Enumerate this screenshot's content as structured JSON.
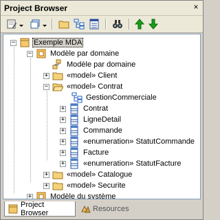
{
  "window": {
    "title": "Project Browser"
  },
  "toolbar": {
    "buttons": [
      "new-element",
      "element-type",
      "new-package",
      "new-diagram",
      "properties",
      "find",
      "move-up",
      "move-down"
    ]
  },
  "tree": {
    "root": "Exemple MDA",
    "domain_model": "Modèle par domaine",
    "domain_diagram": "Modèle par domaine",
    "client_stereo": "«model»",
    "client": "Client",
    "contrat_stereo": "«model»",
    "contrat": "Contrat",
    "gestion": "GestionCommerciale",
    "cls_contrat": "Contrat",
    "cls_ligne": "LigneDetail",
    "cls_commande": "Commande",
    "enum_stereo_1": "«enumeration»",
    "statut_commande": "StatutCommande",
    "cls_facture": "Facture",
    "enum_stereo_2": "«enumeration»",
    "statut_facture": "StatutFacture",
    "catalogue_stereo": "«model»",
    "catalogue": "Catalogue",
    "securite_stereo": "«model»",
    "securite": "Securite",
    "system_model": "Modèle du système"
  },
  "tabs": {
    "project_browser": "Project Browser",
    "resources": "Resources"
  },
  "colors": {
    "folder": "#f5d17a",
    "package": "#e8a030",
    "class": "#4a7ec8",
    "diagram": "#2060c0",
    "arrow": "#18a018"
  }
}
